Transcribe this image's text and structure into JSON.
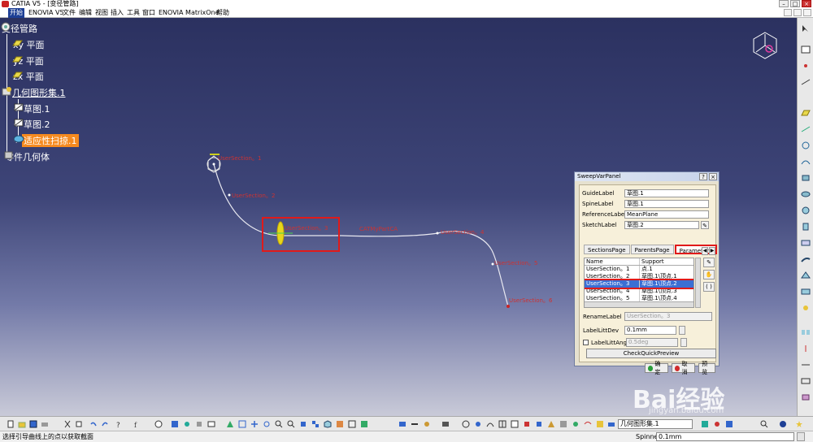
{
  "window": {
    "title": "CATIA V5 - [变径管路]",
    "controls": [
      "–",
      "□",
      "×"
    ]
  },
  "menubar": {
    "items": [
      "开始",
      "ENOVIA V5",
      "文件",
      "编辑",
      "视图",
      "插入",
      "工具",
      "窗口",
      "ENOVIA MatrixOne",
      "帮助"
    ]
  },
  "tree": {
    "root": "变径管路",
    "planes": [
      "xy 平面",
      "yz 平面",
      "zx 平面"
    ],
    "geoset": "几何图形集.1",
    "sketches": [
      "草图.1",
      "草图.2"
    ],
    "sweep": "适应性扫掠.1",
    "body": "零件几何体"
  },
  "viewport_labels": {
    "l1": "UserSection。1",
    "l2": "UserSection。2",
    "l3": "UserSection。3",
    "l4": "UserSection。4",
    "l5": "UserSection。5",
    "l6": "UserSection。6",
    "mid": "CATMyPartCA"
  },
  "panel": {
    "title": "SweepVarPanel",
    "q": "?",
    "x": "×",
    "fields": {
      "guide": {
        "label": "GuideLabel",
        "value": "草图.1"
      },
      "spine": {
        "label": "SpineLabel",
        "value": "草图.1"
      },
      "reference": {
        "label": "ReferenceLabel",
        "value": "MeanPlane"
      },
      "sketch": {
        "label": "SketchLabel",
        "value": "草图.2"
      }
    },
    "tabs": [
      "SectionsPage",
      "ParentsPage",
      "Parameters"
    ],
    "table": {
      "headers": [
        "Name",
        "Support"
      ],
      "rows": [
        {
          "name": "UserSection。1",
          "support": "点.1"
        },
        {
          "name": "UserSection。2",
          "support": "草图.1\\顶点.1"
        },
        {
          "name": "UserSection。3",
          "support": "草图.1\\顶点.2"
        },
        {
          "name": "UserSection。4",
          "support": "草图.1\\顶点.3"
        },
        {
          "name": "UserSection。5",
          "support": "草图.1\\顶点.4"
        }
      ]
    },
    "rename": {
      "label": "RenameLabel",
      "value": "UserSection。3"
    },
    "lawlitdev": {
      "label": "LabelLittDev",
      "value": "0.1mm"
    },
    "lawlitang": {
      "label": "LabelLittAng",
      "value": "0.5deg"
    },
    "quickpreview": "CheckQuickPreview",
    "ok": "确定",
    "cancel": "取消",
    "preview": "预览"
  },
  "bottom_toolbar": {
    "selector": "几何图形集.1"
  },
  "status": {
    "message": "选择引导曲线上的点以获取截面",
    "cmd_label": "Spinner",
    "cmd_value": "0.1mm"
  },
  "watermark": {
    "text": "Bai经验",
    "url": "jingyan.baidu.com"
  }
}
